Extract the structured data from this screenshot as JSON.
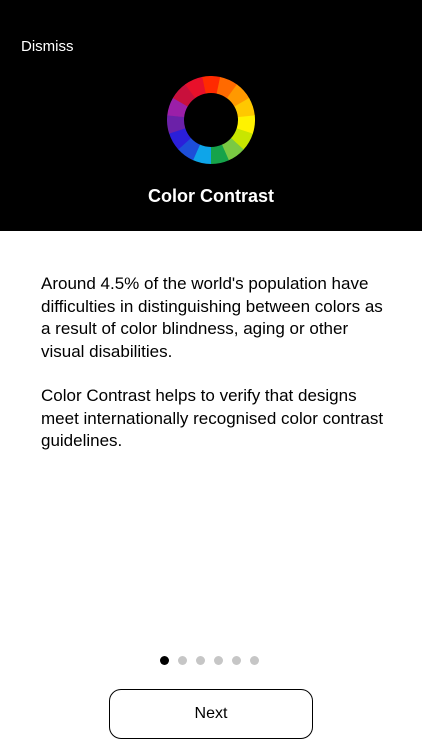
{
  "header": {
    "dismiss_label": "Dismiss",
    "title": "Color Contrast",
    "wheel_icon": "color-wheel-icon",
    "wheel_colors": [
      "#ff2a00",
      "#ff6a00",
      "#ff9900",
      "#ffc800",
      "#fff200",
      "#c8e600",
      "#7ac943",
      "#16a34a",
      "#0ea5e9",
      "#1d4ed8",
      "#2b1fd9",
      "#6b21a8",
      "#9b1fa8",
      "#c8103c",
      "#e8102a"
    ]
  },
  "content": {
    "paragraph_1": "Around 4.5% of the world's population have difficulties in distinguishing between colors as a result of color blindness, aging or other visual disabilities.",
    "paragraph_2": "Color Contrast helps to verify that designs meet internationally recognised color contrast guidelines."
  },
  "pager": {
    "total": 6,
    "current": 1
  },
  "footer": {
    "next_label": "Next"
  },
  "colors": {
    "header_bg": "#000000",
    "dot_active": "#000000",
    "dot_inactive": "#c6c6c6"
  }
}
